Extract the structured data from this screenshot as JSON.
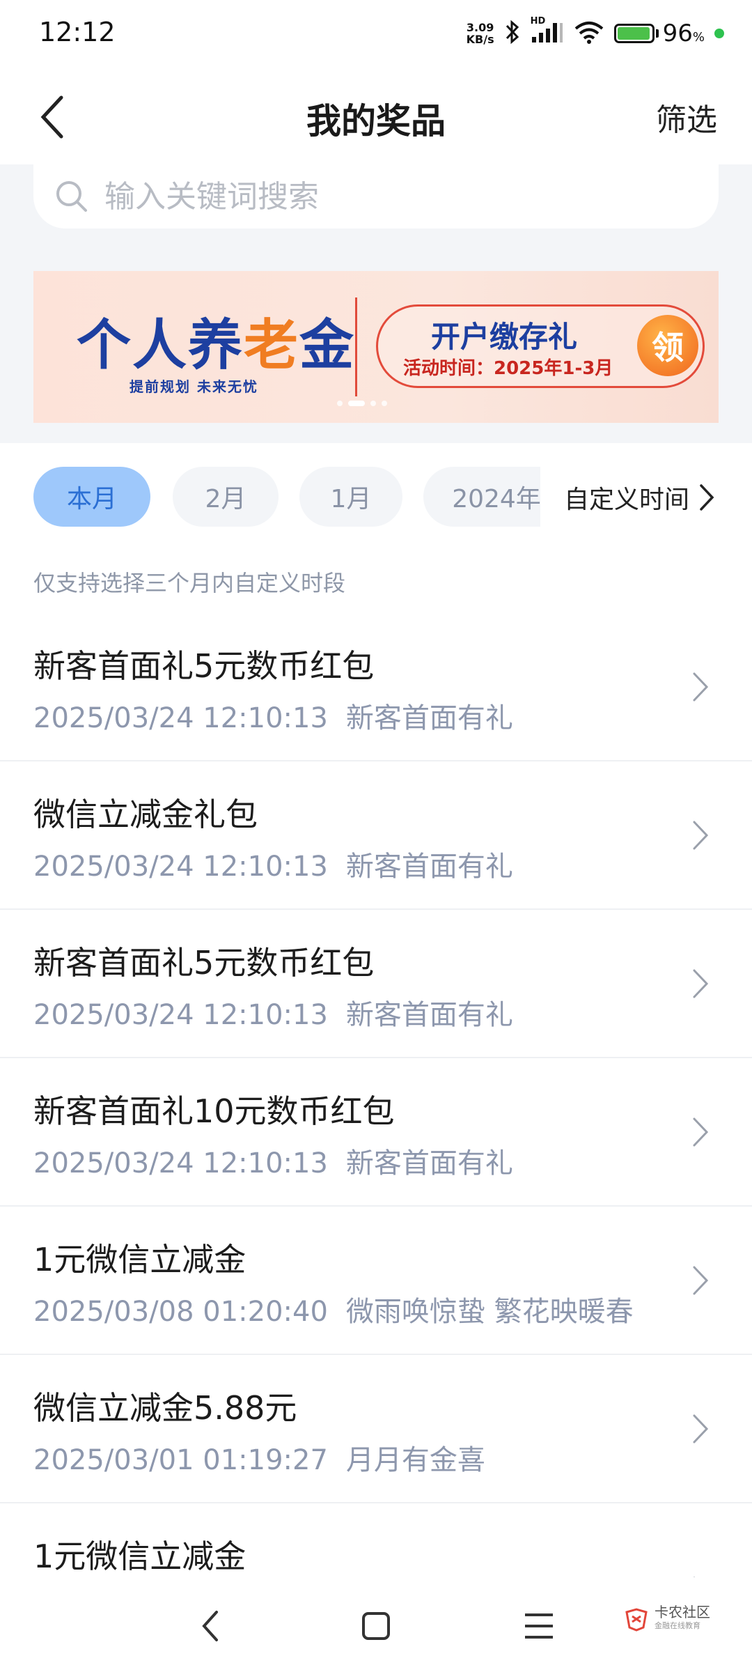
{
  "status_bar": {
    "time": "12:12",
    "net_speed_value": "3.09",
    "net_speed_unit": "KB/s",
    "signal_label": "HD",
    "battery_percent": "96",
    "battery_suffix": "%",
    "battery_level": 0.96
  },
  "header": {
    "title": "我的奖品",
    "filter_label": "筛选",
    "back_icon": "chevron-left-icon"
  },
  "search": {
    "placeholder": "输入关键词搜索",
    "value": ""
  },
  "banner": {
    "logo_part1": "个人养",
    "logo_part2": "老",
    "logo_part3": "金",
    "slogan": "提前规划  未来无忧",
    "pill_title": "开户缴存礼",
    "pill_subtitle": "活动时间：2025年1-3月",
    "badge": "领"
  },
  "chips": {
    "items": [
      "本月",
      "2月",
      "1月",
      "2024年"
    ],
    "selected": "本月",
    "custom_label": "自定义时间"
  },
  "hint": "仅支持选择三个月内自定义时段",
  "prizes": [
    {
      "title": "新客首面礼5元数币红包",
      "time": "2025/03/24 12:10:13",
      "source": "新客首面有礼"
    },
    {
      "title": "微信立减金礼包",
      "time": "2025/03/24 12:10:13",
      "source": "新客首面有礼"
    },
    {
      "title": "新客首面礼5元数币红包",
      "time": "2025/03/24 12:10:13",
      "source": "新客首面有礼"
    },
    {
      "title": "新客首面礼10元数币红包",
      "time": "2025/03/24 12:10:13",
      "source": "新客首面有礼"
    },
    {
      "title": "1元微信立减金",
      "time": "2025/03/08 01:20:40",
      "source": "微雨唤惊蛰 繁花映暖春"
    },
    {
      "title": "微信立减金5.88元",
      "time": "2025/03/01 01:19:27",
      "source": "月月有金喜"
    },
    {
      "title": "1元微信立减金",
      "time": "",
      "source": ""
    }
  ],
  "watermark": {
    "name": "卡农社区",
    "sub": "金融在线教育"
  },
  "colors": {
    "accent": "#9ec8fb",
    "accent_text": "#2b6fd4",
    "meta_text": "#8d97ad",
    "brand_blue": "#1d3fa0",
    "brand_red": "#e34b3b"
  }
}
